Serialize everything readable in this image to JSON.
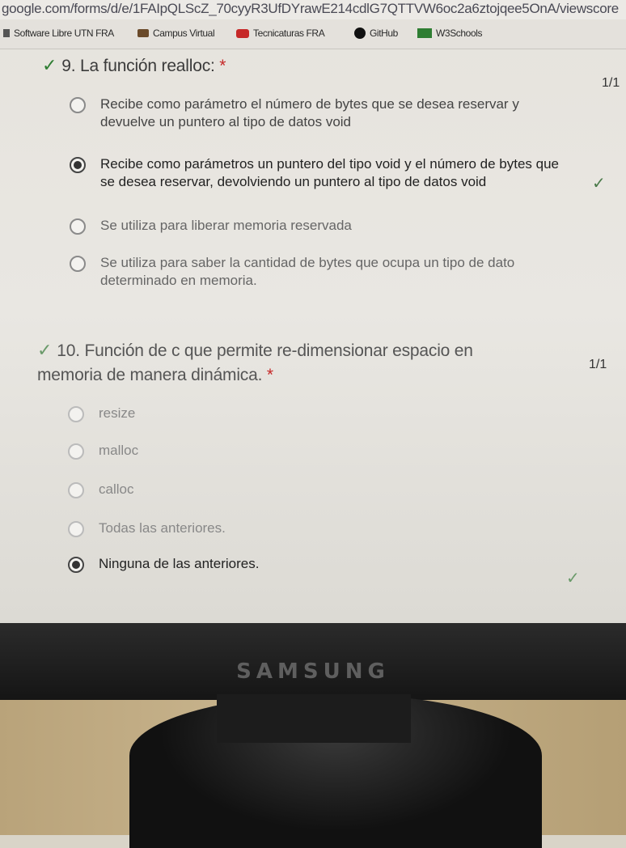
{
  "browser": {
    "url": "google.com/forms/d/e/1FAIpQLScZ_70cyyR3UfDYrawE214cdlG7QTTVW6oc2a6ztojqee5OnA/viewscore"
  },
  "bookmarks": [
    {
      "label": "Software Libre UTN FRA",
      "icon": "page-icon"
    },
    {
      "label": "Campus Virtual",
      "icon": "campus-icon"
    },
    {
      "label": "Tecnicaturas FRA",
      "icon": "youtube-icon"
    },
    {
      "label": "GitHub",
      "icon": "github-icon"
    },
    {
      "label": "W3Schools",
      "icon": "w3schools-icon"
    }
  ],
  "questions": [
    {
      "title": "9. La función realloc:",
      "required": "*",
      "score": "1/1",
      "options": [
        {
          "text": "Recibe como parámetro el número de bytes que se desea reservar y devuelve un puntero al tipo de datos void",
          "selected": false
        },
        {
          "text": "Recibe como parámetros un puntero del tipo void y el número de bytes que se desea reservar, devolviendo un puntero al tipo de datos void",
          "selected": true,
          "correct": true
        },
        {
          "text": "Se utiliza para liberar memoria reservada",
          "selected": false
        },
        {
          "text": "Se utiliza para saber la cantidad de bytes que ocupa un tipo de dato determinado en memoria.",
          "selected": false
        }
      ]
    },
    {
      "title": "10. Función de c que permite re-dimensionar espacio en memoria de manera dinámica.",
      "required": "*",
      "score": "1/1",
      "options": [
        {
          "text": "resize",
          "selected": false
        },
        {
          "text": "malloc",
          "selected": false
        },
        {
          "text": "calloc",
          "selected": false
        },
        {
          "text": "Todas las anteriores.",
          "selected": false
        },
        {
          "text": "Ninguna de las anteriores.",
          "selected": true,
          "correct": true
        }
      ]
    }
  ],
  "monitor": {
    "brand": "SAMSUNG"
  },
  "colors": {
    "correct": "#2e7d32",
    "required": "#c62828"
  }
}
